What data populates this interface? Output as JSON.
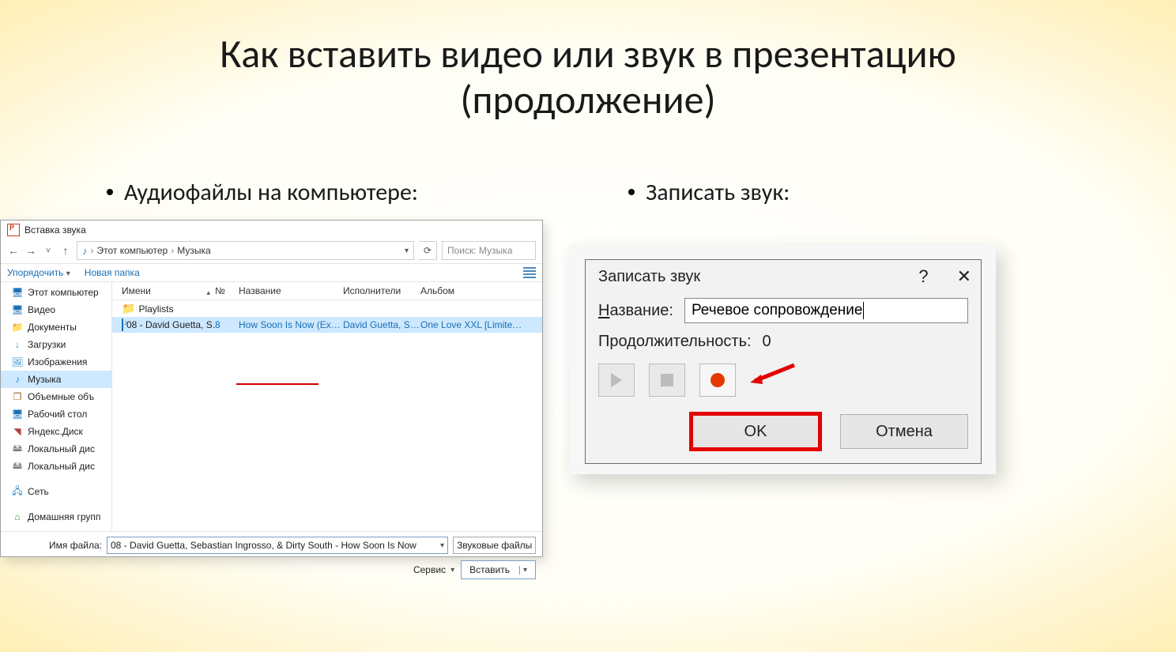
{
  "title": "Как вставить видео или звук в презентацию\n(продолжение)",
  "bullets": {
    "left": "Аудиофайлы на компьютере:",
    "right": "Записать звук:"
  },
  "filedlg": {
    "window_title": "Вставка звука",
    "breadcrumb": {
      "root": "Этот компьютер",
      "folder": "Музыка"
    },
    "search_placeholder": "Поиск: Музыка",
    "toolbar": {
      "organize": "Упорядочить",
      "newfolder": "Новая папка"
    },
    "sidebar": [
      {
        "icon": "ico-monitor",
        "label": "Этот компьютер",
        "key": "sb-pc"
      },
      {
        "icon": "ico-monitor",
        "label": "Видео",
        "key": "sb-video"
      },
      {
        "icon": "ico-folder",
        "label": "Документы",
        "key": "sb-docs"
      },
      {
        "icon": "ico-down",
        "label": "Загрузки",
        "key": "sb-downloads"
      },
      {
        "icon": "ico-pic",
        "label": "Изображения",
        "key": "sb-images"
      },
      {
        "icon": "ico-music",
        "label": "Музыка",
        "key": "sb-music",
        "selected": true
      },
      {
        "icon": "ico-cube",
        "label": "Объемные объ",
        "key": "sb-3d"
      },
      {
        "icon": "ico-monitor",
        "label": "Рабочий стол",
        "key": "sb-desktop"
      },
      {
        "icon": "ico-yadisk",
        "label": "Яндекс.Диск",
        "key": "sb-yadisk"
      },
      {
        "icon": "ico-disk",
        "label": "Локальный дис",
        "key": "sb-disk1"
      },
      {
        "icon": "ico-disk",
        "label": "Локальный дис",
        "key": "sb-disk2"
      },
      {
        "gap": true
      },
      {
        "icon": "ico-net",
        "label": "Сеть",
        "key": "sb-network"
      },
      {
        "gap": true
      },
      {
        "icon": "ico-home",
        "label": "Домашняя групп",
        "key": "sb-homegroup"
      }
    ],
    "columns": {
      "name": "Имени",
      "num": "№",
      "title": "Название",
      "perf": "Исполнители",
      "album": "Альбом"
    },
    "rows": [
      {
        "type": "folder",
        "name": "Playlists"
      },
      {
        "type": "audio",
        "selected": true,
        "name": "08 - David Guetta, S…",
        "num": "8",
        "title": "How Soon Is Now (Extend…",
        "perf": "David Guetta, Seb…",
        "album": "One Love XXL [Limite…"
      }
    ],
    "filename_label": "Имя файла:",
    "filename_value": "08 - David Guetta, Sebastian Ingrosso, & Dirty South - How Soon Is Now",
    "filter": "Звуковые файлы",
    "service": "Сервис",
    "insert": "Вставить"
  },
  "recdlg": {
    "title": "Записать звук",
    "name_label_u": "Н",
    "name_label_rest": "азвание:",
    "name_value": "Речевое сопровождение",
    "duration_label": "Продолжительность:",
    "duration_value": "0",
    "ok": "OK",
    "cancel": "Отмена"
  }
}
